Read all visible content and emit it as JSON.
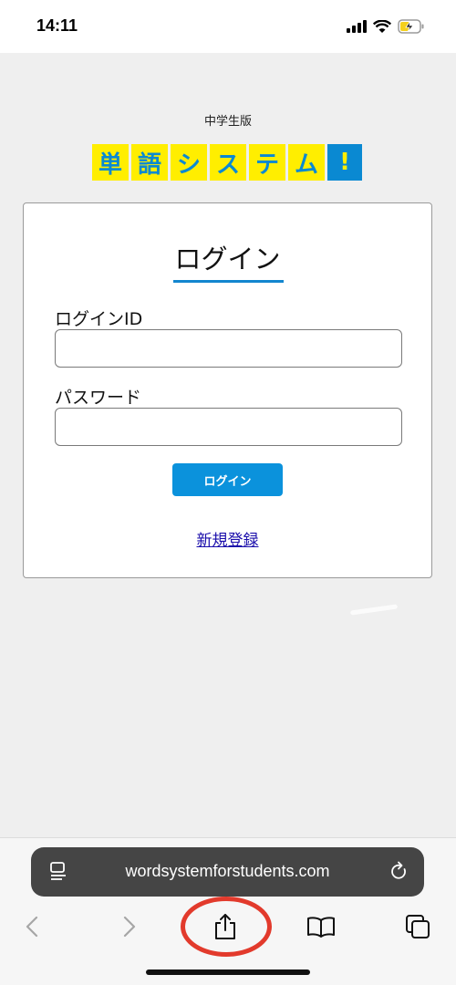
{
  "status_bar": {
    "time": "14:11"
  },
  "header": {
    "edition": "中学生版",
    "logo_chars": [
      "単",
      "語",
      "シ",
      "ス",
      "テ",
      "ム",
      "!"
    ]
  },
  "login_card": {
    "title": "ログイン",
    "id_label": "ログインID",
    "id_value": "",
    "password_label": "パスワード",
    "password_value": "",
    "login_button": "ログイン",
    "register_link": "新規登録"
  },
  "browser": {
    "url": "wordsystemforstudents.com",
    "toolbar_icons": [
      "back-icon",
      "forward-icon",
      "share-icon",
      "bookmarks-icon",
      "tabs-icon"
    ]
  },
  "colors": {
    "logo_yellow": "#ffee00",
    "logo_blue": "#0a89d2",
    "button_blue": "#0b92dc",
    "highlight_red": "#e23a2c"
  }
}
